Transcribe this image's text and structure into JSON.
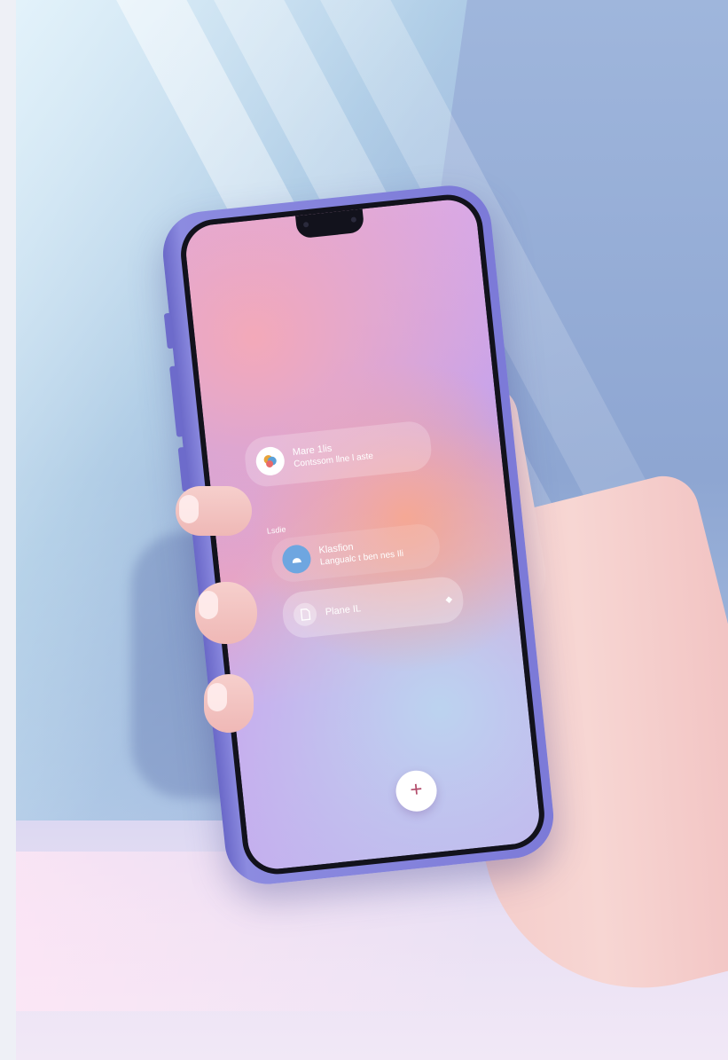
{
  "scene": {
    "description_colors": {
      "wall": "#8ea6d2",
      "phone_body": "#7c7ad8",
      "table": "#e9e0f4"
    }
  },
  "phone": {
    "cards": [
      {
        "title": "Mare 1lis",
        "subtitle": "Contssom llne l aste",
        "icon": "multicolor-app-icon"
      },
      {
        "title": "Klasfion",
        "subtitle": "Langualc t ben nes Ili",
        "icon": "blue-app-icon"
      },
      {
        "title": "Plane  IL",
        "subtitle": "",
        "icon": "document-icon",
        "trailing_icon": "pin-icon"
      }
    ],
    "section_label": "Lsdie",
    "fab_label": "+"
  }
}
